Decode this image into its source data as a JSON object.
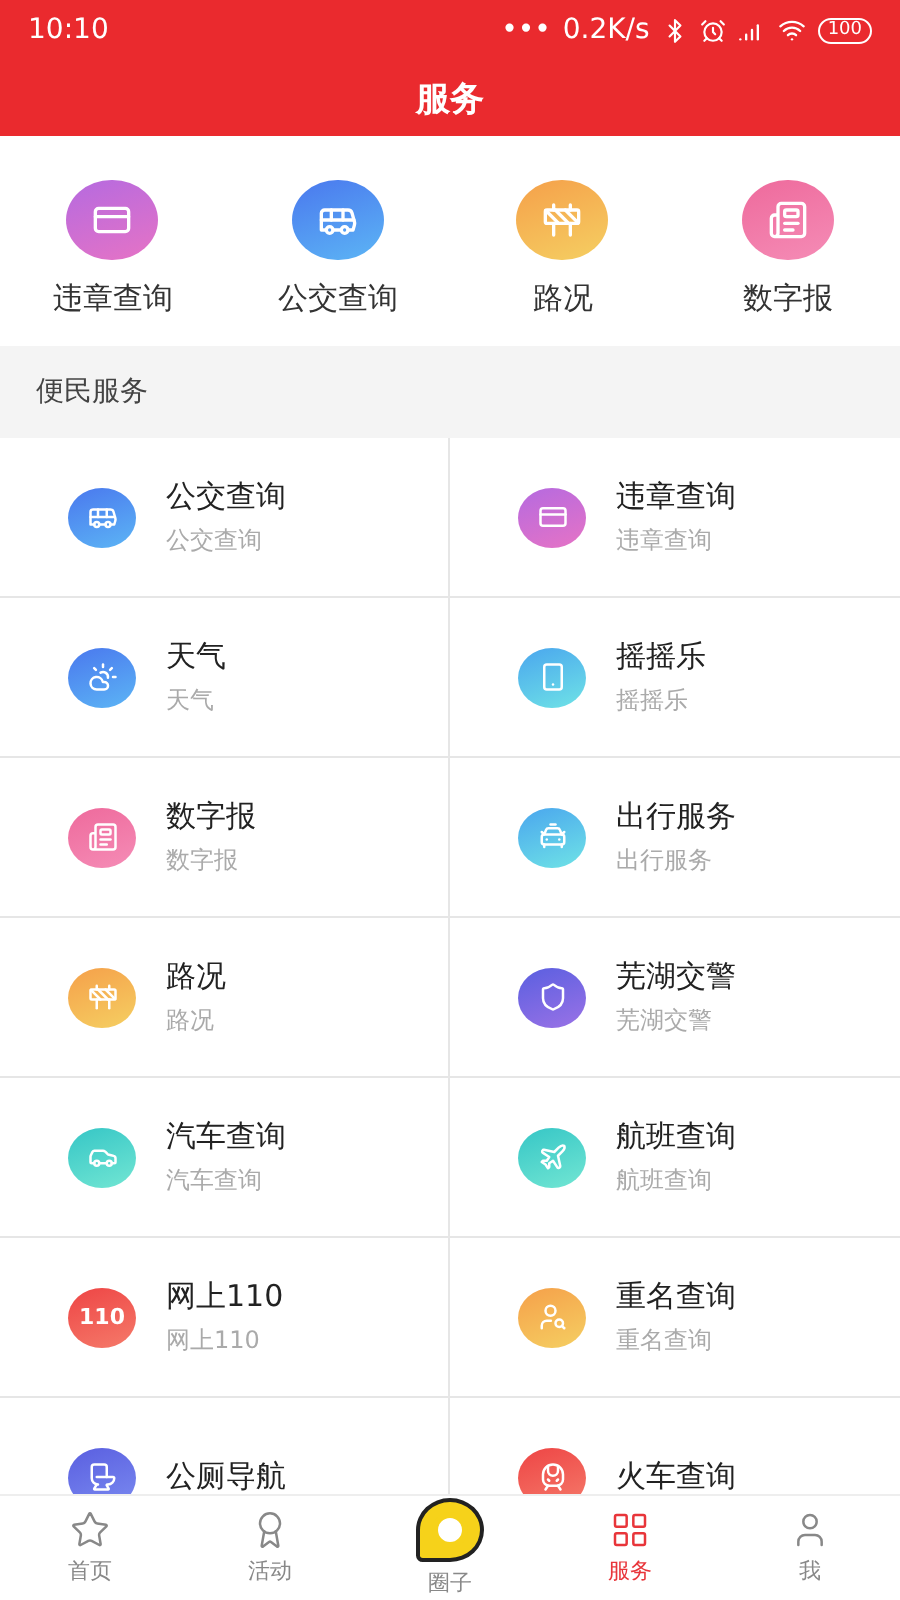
{
  "status_bar": {
    "time": "10:10",
    "dots": "•••",
    "speed": "0.2K/s",
    "battery": "100"
  },
  "header": {
    "title": "服务"
  },
  "quick_links": [
    {
      "label": "违章查询"
    },
    {
      "label": "公交查询"
    },
    {
      "label": "路况"
    },
    {
      "label": "数字报"
    }
  ],
  "section": {
    "title": "便民服务"
  },
  "services": [
    {
      "title": "公交查询",
      "subtitle": "公交查询"
    },
    {
      "title": "违章查询",
      "subtitle": "违章查询"
    },
    {
      "title": "天气",
      "subtitle": "天气"
    },
    {
      "title": "摇摇乐",
      "subtitle": "摇摇乐"
    },
    {
      "title": "数字报",
      "subtitle": "数字报"
    },
    {
      "title": "出行服务",
      "subtitle": "出行服务"
    },
    {
      "title": "路况",
      "subtitle": "路况"
    },
    {
      "title": "芜湖交警",
      "subtitle": "芜湖交警"
    },
    {
      "title": "汽车查询",
      "subtitle": "汽车查询"
    },
    {
      "title": "航班查询",
      "subtitle": "航班查询"
    },
    {
      "title": "网上110",
      "subtitle": "网上110",
      "icon_text": "110"
    },
    {
      "title": "重名查询",
      "subtitle": "重名查询"
    },
    {
      "title": "公厕导航"
    },
    {
      "title": "火车查询"
    }
  ],
  "tab_bar": [
    {
      "label": "首页",
      "selected": false
    },
    {
      "label": "活动",
      "selected": false
    },
    {
      "label": "圈子",
      "selected": false
    },
    {
      "label": "服务",
      "selected": true
    },
    {
      "label": "我",
      "selected": false
    }
  ]
}
